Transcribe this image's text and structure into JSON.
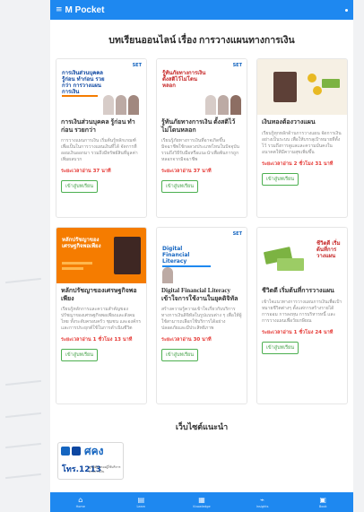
{
  "app": {
    "title": "M Pocket"
  },
  "section_title": "บทเรียนออนไลน์ เรื่อง การวางแผนทางการเงิน",
  "cards": [
    {
      "title": "การเงินส่วนบุคคล รู้ก่อน ทำก่อน รวยกว่า",
      "description": "การวางแผนการเงิน เริ่มต้นรู้หลักเกณฑ์เพื่อเป็นในการวางแผนเงินที่ได้ จัดการที่ออมเงินออกมา รวมถึงมีทรัพย์สินที่มูลค่าเพิ่มผลบวก",
      "read_time": "ระยะเวลาอ่าน 37 นาที",
      "button": "เข้าสู่บทเรียน",
      "thumb_text": "การเงินส่วนบุคคล รู้ก่อน ทำก่อน รวยกว่า การวางแผนการเงิน",
      "brand": "SET"
    },
    {
      "title": "รู้ทันภัยทางการเงิน ตั้งสติไว้ไม่โดนหลอก",
      "description": "เรียนรู้ภัยทางการเงินที่อาจเกิดขึ้น มิจฉาชีพใช้กลลวงประเภทไหนในปัจจุบัน รวมถึงวิธีรับมือหรือแนะนำเพื่อพ้นการถูกหลอกจากมิจฉาชีพ",
      "read_time": "ระยะเวลาอ่าน 37 นาที",
      "button": "เข้าสู่บทเรียน",
      "thumb_text": "รู้ทันภัยทางการเงิน ตั้งสติไว้ไม่โดนหลอก",
      "brand": "SET"
    },
    {
      "title": "เงินทองต้องวางแผน",
      "description": "เรียนรู้ทุกหลักด้านการวางแผน จัดการเงินอย่างเป็นระบบ เพื่อให้บรรลุเป้าหมายที่ตั้งไว้ รวมถึงการดูแลและความมั่นคงในอนาคตให้มีความสุขเพิ่มขึ้น",
      "read_time": "ระยะเวลาอ่าน 2 ชั่วโมง 31 นาที",
      "button": "เข้าสู่บทเรียน",
      "thumb_text": "",
      "brand": ""
    },
    {
      "title": "หลักปรัชญาของเศรษฐกิจพอเพียง",
      "description": "เรียนรู้หลักการและความสำคัญของปรัชญาของเศรษฐกิจพอเพียงและสังคมไทย ทั้งระดับครอบครัว ชุมชน และองค์กร และการประยุกต์ใช้ในการดำเนินชีวิต",
      "read_time": "ระยะเวลาอ่าน 1 ชั่วโมง 13 นาที",
      "button": "เข้าสู่บทเรียน",
      "thumb_text": "หลักปรัชญาของเศรษฐกิจพอเพียง",
      "brand": ""
    },
    {
      "title": "Digital Financial Literacy เข้าใจการใช้งานในยุคดิจิทัล",
      "description": "สร้างความรู้ความเข้าใจเกี่ยวกับบริการทางการเงินดิจิทัลในรูปแบบต่าง ๆ เพื่อให้ผู้ใช้สามารถเลือกใช้บริการได้อย่างปลอดภัยและมีประสิทธิภาพ",
      "read_time": "ระยะเวลาอ่าน 30 นาที",
      "button": "เข้าสู่บทเรียน",
      "thumb_text": "Digital Financial Literacy",
      "brand": "SET"
    },
    {
      "title": "ชีวิตดี เริ่มต้นที่การวางแผน",
      "description": "เข้าใจแนวทางการวางแผนการเงินเพื่อเป้าหมายชีวิตต่างๆ ตั้งแต่การสร้างรายได้ การออม การลงทุน การบริหารหนี้ และการวางแผนเพื่อวัยเกษียณ",
      "read_time": "ระยะเวลาอ่าน 1 ชั่วโมง 24 นาที",
      "button": "เข้าสู่บทเรียน",
      "thumb_text": "ชีวิตดี เริ่มต้นที่การวางแผน",
      "brand": ""
    }
  ],
  "recommended": {
    "title": "เว็บไซต์แนะนำ",
    "logo_big": "ศคง",
    "logo_number": "โทร.1213",
    "logo_caption": "ศูนย์คุ้มครองผู้ใช้บริการทางการเงิน"
  },
  "bottom_nav": [
    {
      "label": "Home",
      "icon": "home-icon",
      "glyph": "⌂"
    },
    {
      "label": "Learn",
      "icon": "book-icon",
      "glyph": "▤"
    },
    {
      "label": "Knowledge",
      "icon": "cards-icon",
      "glyph": "▦"
    },
    {
      "label": "Insights",
      "icon": "chart-icon",
      "glyph": "⌁"
    },
    {
      "label": "Book",
      "icon": "bookmark-icon",
      "glyph": "▣"
    }
  ],
  "colors": {
    "primary": "#1e88f0",
    "read_time": "#e53935",
    "button": "#43a047"
  }
}
